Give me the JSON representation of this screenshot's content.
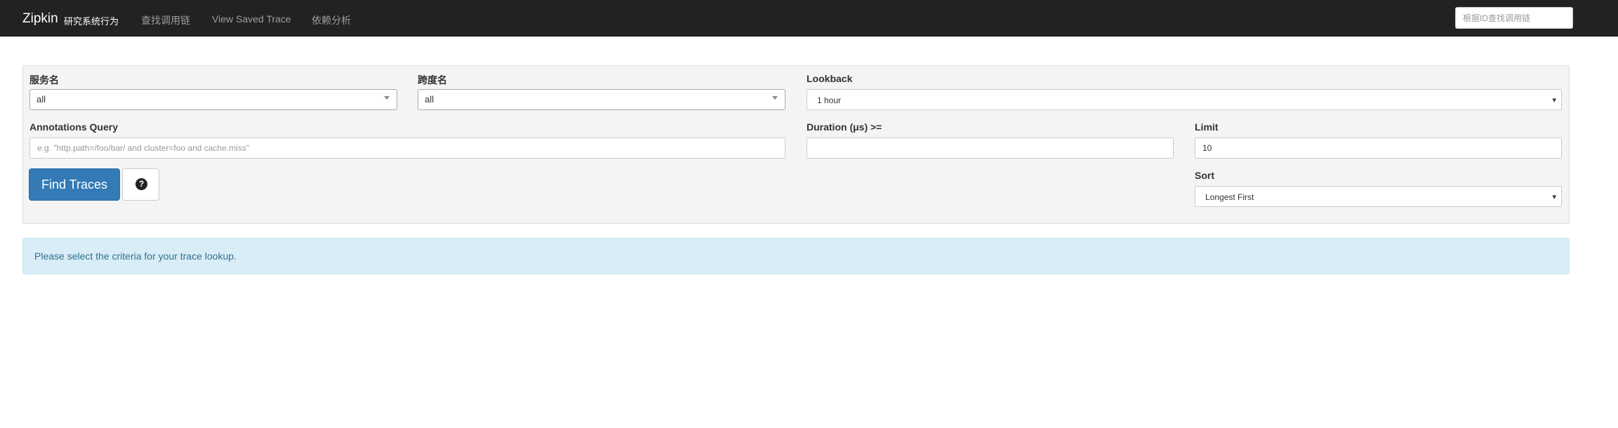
{
  "navbar": {
    "brand": "Zipkin",
    "subtitle": "研究系统行为",
    "links": [
      "查找调用链",
      "View Saved Trace",
      "依赖分析"
    ],
    "search_placeholder": "根据ID查找调用链"
  },
  "form": {
    "service": {
      "label": "服务名",
      "value": "all"
    },
    "span": {
      "label": "跨度名",
      "value": "all"
    },
    "lookback": {
      "label": "Lookback",
      "value": "1 hour"
    },
    "annotations": {
      "label": "Annotations Query",
      "value": "",
      "placeholder": "e.g. \"http.path=/foo/bar/ and cluster=foo and cache.miss\""
    },
    "duration": {
      "label": "Duration (μs) >=",
      "value": ""
    },
    "limit": {
      "label": "Limit",
      "value": "10"
    },
    "sort": {
      "label": "Sort",
      "value": "Longest First"
    },
    "find_button": "Find Traces",
    "help_icon_glyph": "?"
  },
  "alert": {
    "text": "Please select the criteria for your trace lookup."
  },
  "colors": {
    "navbar": "#222222",
    "primary": "#337ab7",
    "alert_bg": "#d9edf7",
    "alert_text": "#31708f"
  }
}
